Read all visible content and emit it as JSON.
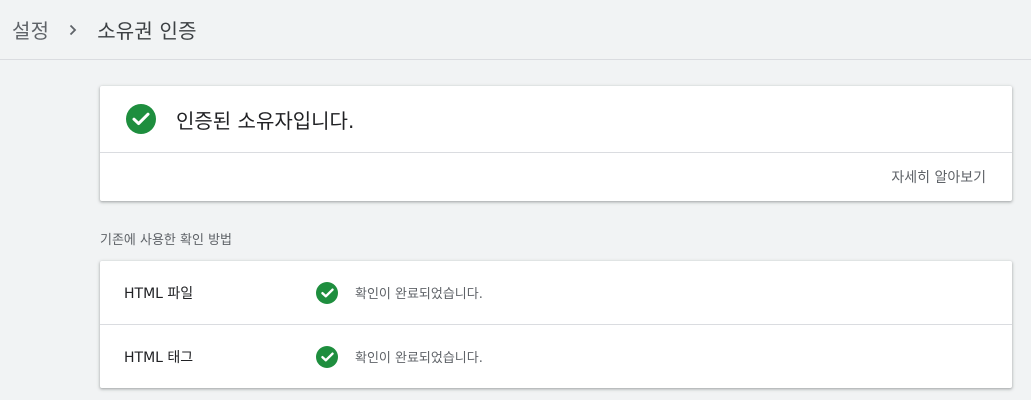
{
  "header": {
    "breadcrumb_parent": "설정",
    "breadcrumb_current": "소유권 인증"
  },
  "status": {
    "message": "인증된 소유자입니다.",
    "learn_more": "자세히 알아보기"
  },
  "methods_section": {
    "title": "기존에 사용한 확인 방법",
    "items": [
      {
        "name": "HTML 파일",
        "status": "확인이 완료되었습니다."
      },
      {
        "name": "HTML 태그",
        "status": "확인이 완료되었습니다."
      }
    ]
  },
  "colors": {
    "success": "#1e8e3e",
    "background": "#f1f3f4",
    "card": "#ffffff"
  }
}
